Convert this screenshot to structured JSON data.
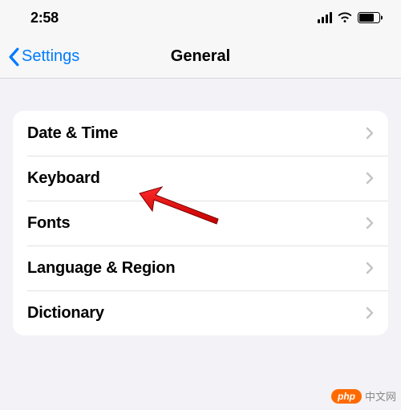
{
  "statusbar": {
    "time": "2:58"
  },
  "navbar": {
    "back_label": "Settings",
    "title": "General"
  },
  "menu": {
    "items": [
      {
        "label": "Date & Time"
      },
      {
        "label": "Keyboard"
      },
      {
        "label": "Fonts"
      },
      {
        "label": "Language & Region"
      },
      {
        "label": "Dictionary"
      }
    ]
  },
  "watermark": {
    "badge": "php",
    "text": "中文网"
  }
}
